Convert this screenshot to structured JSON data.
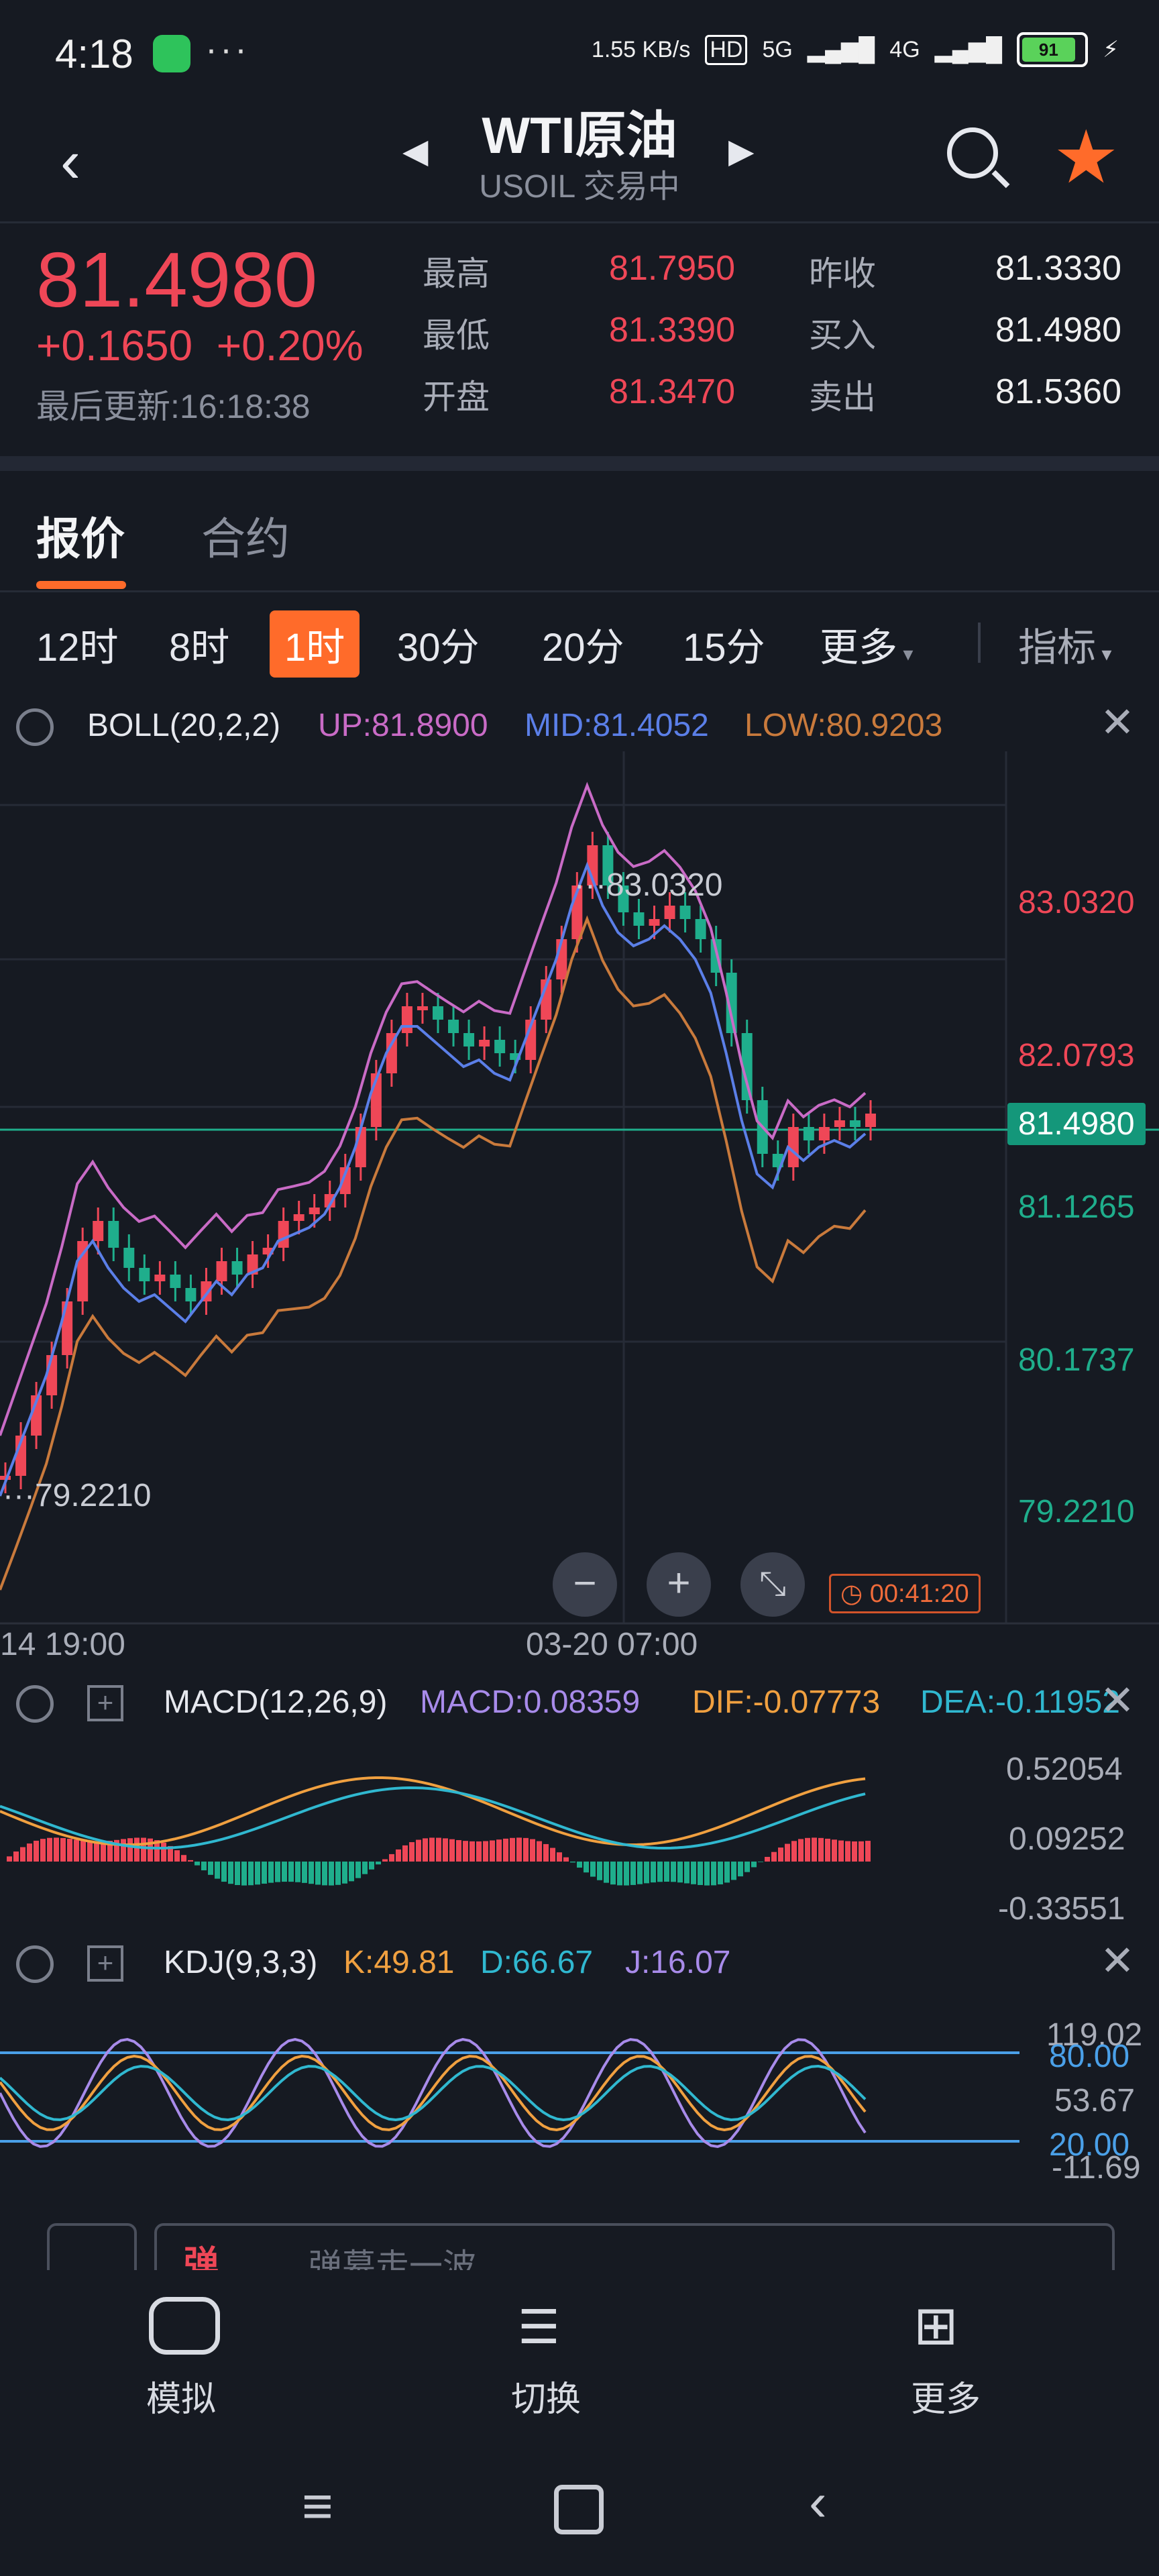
{
  "status_bar": {
    "time": "4:18",
    "dots": "···",
    "speed": "1.55 KB/s",
    "hd": "HD",
    "net1": "5G",
    "net2": "4G",
    "battery": "91"
  },
  "header": {
    "title": "WTI原油",
    "subtitle": "USOIL 交易中"
  },
  "quote": {
    "price": "81.4980",
    "change": "+0.1650",
    "change_pct": "+0.20%",
    "last_update": "最后更新:16:18:38",
    "high_label": "最高",
    "high": "81.7950",
    "low_label": "最低",
    "low": "81.3390",
    "open_label": "开盘",
    "open": "81.3470",
    "prev_close_label": "昨收",
    "prev_close": "81.3330",
    "bid_label": "买入",
    "bid": "81.4980",
    "ask_label": "卖出",
    "ask": "81.5360"
  },
  "tabs": [
    "报价",
    "合约"
  ],
  "timeframes": [
    "12时",
    "8时",
    "1时",
    "30分",
    "20分",
    "15分",
    "更多"
  ],
  "indicator_menu": "指标",
  "boll": {
    "name": "BOLL(20,2,2)",
    "up": "UP:81.8900",
    "mid": "MID:81.4052",
    "low": "LOW:80.9203"
  },
  "price_axis": [
    "83.0320",
    "82.0793",
    "81.4980",
    "81.1265",
    "80.1737",
    "79.2210"
  ],
  "chart_labels": {
    "high_mark": "83.0320",
    "low_mark": "79.2210",
    "countdown": "00:41:20",
    "time_left": "14 19:00",
    "time_mid": "03-20 07:00"
  },
  "macd": {
    "name": "MACD(12,26,9)",
    "macd": "MACD:0.08359",
    "dif": "DIF:-0.07773",
    "dea": "DEA:-0.11952",
    "axis": [
      "0.52054",
      "0.09252",
      "-0.33551"
    ]
  },
  "kdj": {
    "name": "KDJ(9,3,3)",
    "k": "K:49.81",
    "d": "D:66.67",
    "j": "J:16.07",
    "axis": [
      "119.02",
      "80.00",
      "53.67",
      "20.00",
      "-11.69"
    ]
  },
  "comment": {
    "badge": "弹",
    "placeholder": "弹幕走一波"
  },
  "bottom_nav": [
    "模拟",
    "切换",
    "更多"
  ],
  "colors": {
    "bg": "#161a22",
    "up": "#ef4757",
    "down": "#1fae8c",
    "accent": "#ff6b2a",
    "boll_up": "#c96bc6",
    "boll_mid": "#5b7fe8",
    "boll_low": "#c97a3c"
  }
}
